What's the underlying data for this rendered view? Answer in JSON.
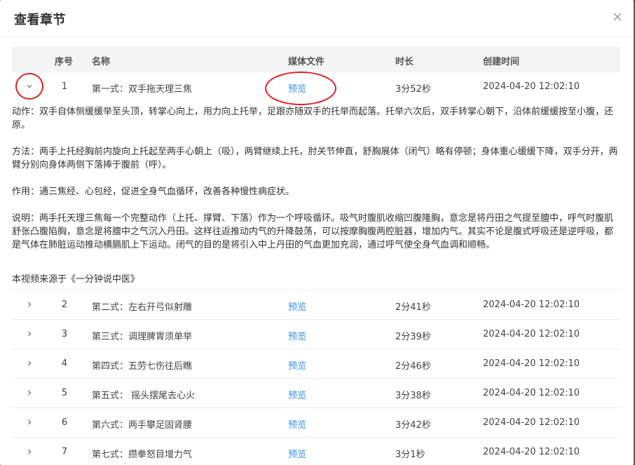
{
  "dialog": {
    "title": "查看章节",
    "close_icon": "close-icon"
  },
  "table": {
    "headers": {
      "index": "序号",
      "name": "名称",
      "media": "媒体文件",
      "duration": "时长",
      "created": "创建时间"
    },
    "rows": [
      {
        "index": "1",
        "name": "第一式：双手拖天理三焦",
        "media": "预览",
        "duration": "3分52秒",
        "created": "2024-04-20 12:02:10",
        "expanded": true
      },
      {
        "index": "2",
        "name": "第二式：左右开弓似射雕",
        "media": "预览",
        "duration": "2分41秒",
        "created": "2024-04-20 12:02:10",
        "expanded": false
      },
      {
        "index": "3",
        "name": "第三式：调理脾胃须单举",
        "media": "预览",
        "duration": "2分39秒",
        "created": "2024-04-20 12:02:10",
        "expanded": false
      },
      {
        "index": "4",
        "name": "第四式：五劳七伤往后瞧",
        "media": "预览",
        "duration": "2分46秒",
        "created": "2024-04-20 12:02:10",
        "expanded": false
      },
      {
        "index": "5",
        "name": "第五式： 摇头摆尾去心火",
        "media": "预览",
        "duration": "3分38秒",
        "created": "2024-04-20 12:02:10",
        "expanded": false
      },
      {
        "index": "6",
        "name": "第六式：两手攀足固肾腰",
        "media": "预览",
        "duration": "3分42秒",
        "created": "2024-04-20 12:02:10",
        "expanded": false
      },
      {
        "index": "7",
        "name": "第七式：攒拳怒目增力气",
        "media": "预览",
        "duration": "3分1秒",
        "created": "2024-04-20 12:02:10",
        "expanded": false
      }
    ]
  },
  "detail": {
    "action": "动作：双手自体侧缓缓举至头顶，转掌心向上，用力向上托举，足跟亦随双手的托举而起落。托举六次后，双手转掌心朝下，沿体前缓缓按至小腹，还原。",
    "method": "方法：两手上托经胸前内旋向上托起至两手心朝上（吸），两臂继续上托，肘关节伸直，舒胸展体（闭气）略有停顿；身体重心缓缓下降，双手分开，两臂分别向身体两侧下落捧于腹前（呼）。",
    "effect": "作用：通三焦经、心包经，促进全身气血循环，改善各种慢性病症状。",
    "explanation": "说明：两手托天理三焦每一个完整动作（上托、撑臂、下落）作为一个呼吸循环。吸气时腹肌收缩凹腹隆胸，意念是将丹田之气提至膻中，呼气时腹肌舒张凸腹陷胸，意念是将膻中之气沉入丹田。这样往返推动内气的升降鼓荡，可以按摩胸腹两腔脏器，增加内气。其实不论是腹式呼吸还是逆呼吸，都是气体在肺脏运动推动横膈肌上下运动。闭气的目的是将引入中上丹田的气血更加充润，通过呼气使全身气血调和顺畅。",
    "source": "本视频来源于《一分钟说中医》"
  },
  "colors": {
    "link": "#3a8ee6",
    "annotation": "#e02020",
    "header_bg": "#f2f4f7"
  }
}
